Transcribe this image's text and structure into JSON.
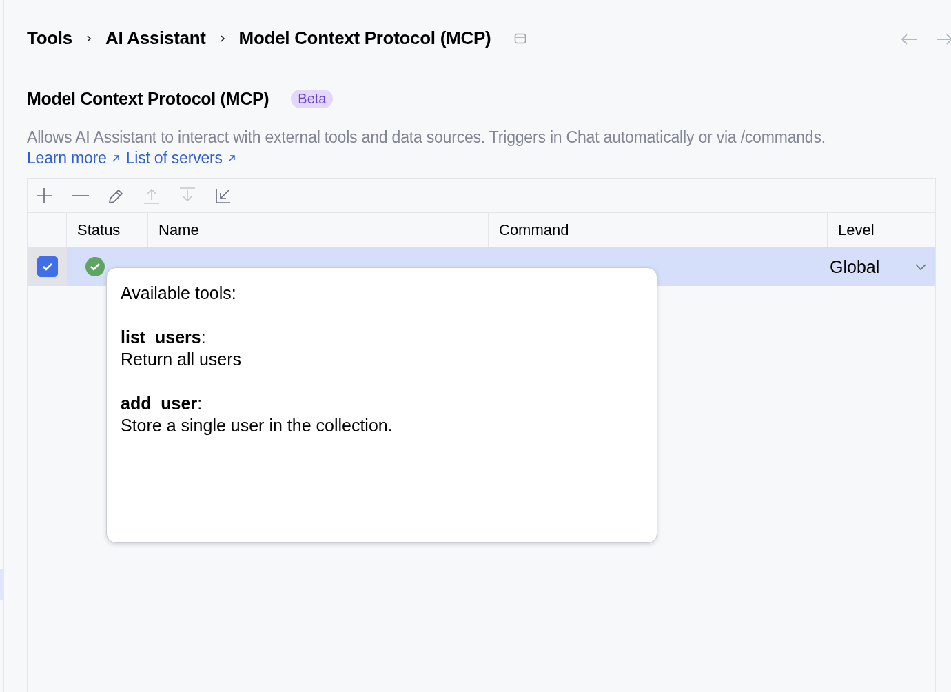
{
  "breadcrumbs": [
    {
      "label": "Tools"
    },
    {
      "label": "AI Assistant"
    },
    {
      "label": "Model Context Protocol (MCP)"
    }
  ],
  "heading": {
    "title": "Model Context Protocol (MCP)",
    "badge": "Beta"
  },
  "description": {
    "text": "Allows AI Assistant to interact with external tools and data sources. Triggers in Chat automatically or via /commands.",
    "links": [
      "Learn more",
      "List of servers"
    ]
  },
  "toolbar": [
    {
      "kind": "add",
      "disabled": false
    },
    {
      "kind": "remove",
      "disabled": false
    },
    {
      "kind": "edit",
      "disabled": false
    },
    {
      "kind": "move-up",
      "disabled": true
    },
    {
      "kind": "move-down",
      "disabled": true
    },
    {
      "kind": "import",
      "disabled": false
    }
  ],
  "table": {
    "columns": [
      "Status",
      "Name",
      "Command",
      "Level"
    ],
    "rows": [
      {
        "checked": true,
        "selected": true,
        "running": true,
        "level": "Global"
      }
    ]
  },
  "tooltip": {
    "title": "Available tools:",
    "tools": [
      {
        "heading": "**list_users**:",
        "description": "Return all users"
      },
      {
        "heading": "**add_user**:",
        "description": "Store a single user in the collection."
      }
    ]
  }
}
